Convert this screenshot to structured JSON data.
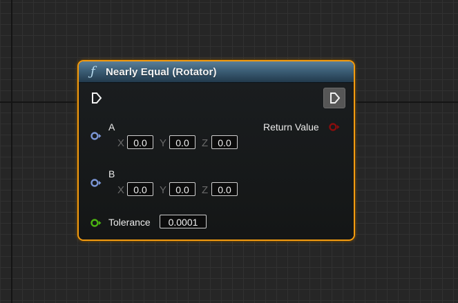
{
  "node": {
    "title": "Nearly Equal (Rotator)",
    "function_icon_glyph": "ƒ",
    "border_color": "#f39c12",
    "header_color": "#3c5e76"
  },
  "pins": {
    "a": {
      "label": "A",
      "x_label": "X",
      "x_value": "0.0",
      "y_label": "Y",
      "y_value": "0.0",
      "z_label": "Z",
      "z_value": "0.0",
      "pin_color": "#7b96d6"
    },
    "b": {
      "label": "B",
      "x_label": "X",
      "x_value": "0.0",
      "y_label": "Y",
      "y_value": "0.0",
      "z_label": "Z",
      "z_value": "0.0",
      "pin_color": "#7b96d6"
    },
    "tolerance": {
      "label": "Tolerance",
      "value": "0.0001",
      "pin_color": "#4cb511"
    },
    "return_value": {
      "label": "Return Value",
      "pin_color": "#8a0d0d"
    }
  },
  "icons": {
    "exec_in": "exec-pin-in-icon",
    "exec_out": "exec-pin-out-icon"
  }
}
